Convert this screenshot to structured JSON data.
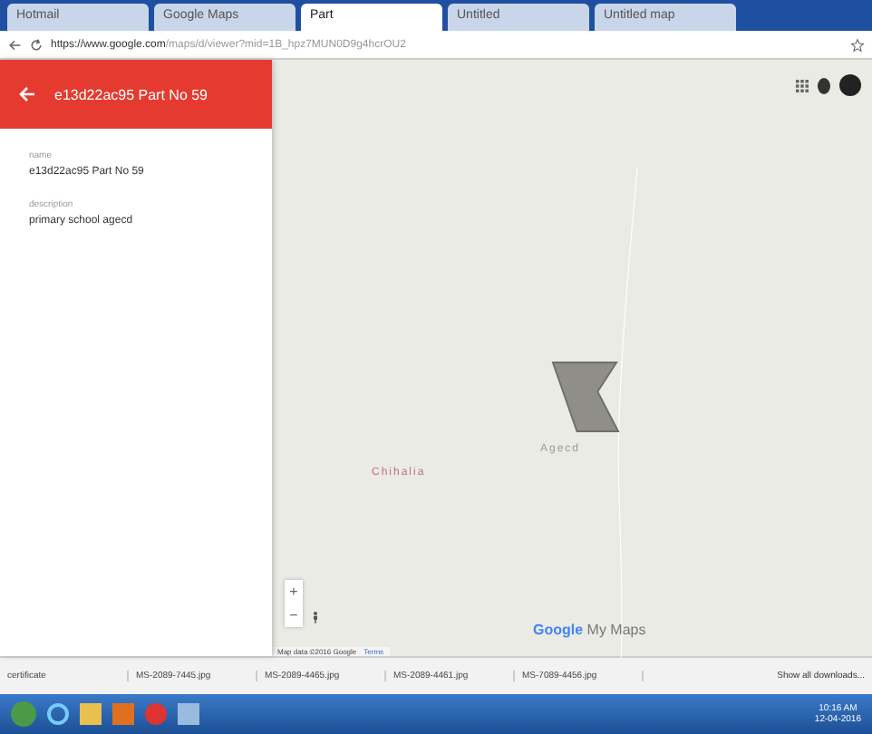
{
  "browser": {
    "tabs": [
      {
        "label": "Hotmail",
        "selected": false
      },
      {
        "label": "Google Maps",
        "selected": false
      },
      {
        "label": "Part",
        "selected": true
      },
      {
        "label": "Untitled",
        "selected": false
      },
      {
        "label": "Untitled map",
        "selected": false
      }
    ],
    "url_host": "https://www.google.com",
    "url_path": "/maps/d/viewer?mid=1B_hpz7MUN0D9g4hcrOU2"
  },
  "panel": {
    "title": "e13d22ac95 Part No 59",
    "fields": [
      {
        "label": "name",
        "value": "e13d22ac95 Part No 59"
      },
      {
        "label": "description",
        "value": "primary school agecd"
      }
    ]
  },
  "map": {
    "labels": [
      "Agecd",
      "Chihalia"
    ],
    "zoom_in": "+",
    "zoom_out": "−",
    "logo_google": "Google",
    "logo_mymaps": "My Maps",
    "attribution": "Map data ©2016 Google",
    "terms": "Terms"
  },
  "downloads": {
    "items": [
      "certificate",
      "MS-2089-7445.jpg",
      "MS-2089-4465.jpg",
      "MS-2089-4461.jpg",
      "MS-7089-4456.jpg"
    ],
    "show_all": "Show all downloads..."
  },
  "taskbar": {
    "time": "10:16 AM",
    "date": "12-04-2016"
  }
}
